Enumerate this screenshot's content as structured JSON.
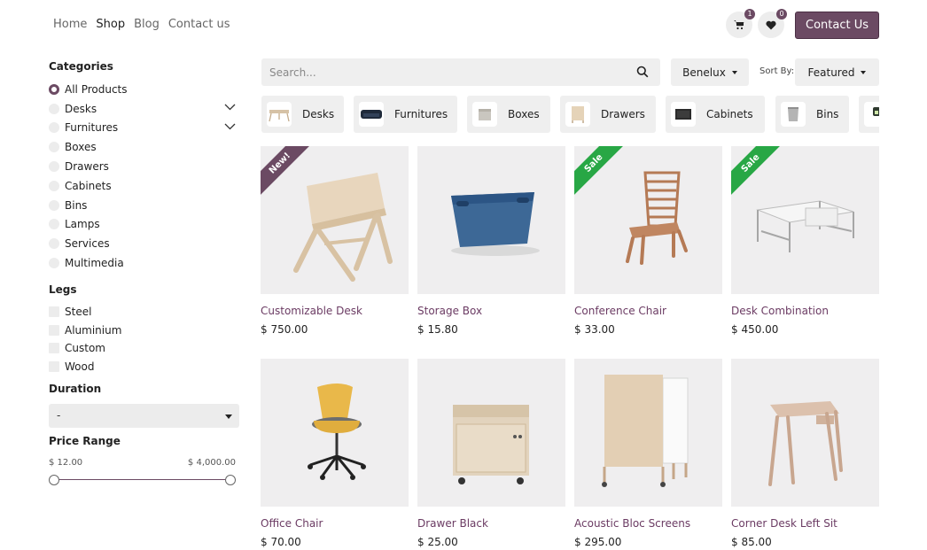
{
  "nav": {
    "items": [
      {
        "label": "Home",
        "active": false
      },
      {
        "label": "Shop",
        "active": true
      },
      {
        "label": "Blog",
        "active": false
      },
      {
        "label": "Contact us",
        "active": false
      }
    ],
    "cart_count": "1",
    "wishlist_count": "0",
    "contact_button": "Contact Us"
  },
  "colors": {
    "brand": "#6b4a63",
    "product_name": "#6b3b63",
    "ribbon_new": "#6b4a63",
    "ribbon_sale": "#28a745"
  },
  "sidebar": {
    "categories_title": "Categories",
    "categories": [
      {
        "label": "All Products",
        "checked": true,
        "expandable": false
      },
      {
        "label": "Desks",
        "checked": false,
        "expandable": true
      },
      {
        "label": "Furnitures",
        "checked": false,
        "expandable": true
      },
      {
        "label": "Boxes",
        "checked": false,
        "expandable": false
      },
      {
        "label": "Drawers",
        "checked": false,
        "expandable": false
      },
      {
        "label": "Cabinets",
        "checked": false,
        "expandable": false
      },
      {
        "label": "Bins",
        "checked": false,
        "expandable": false
      },
      {
        "label": "Lamps",
        "checked": false,
        "expandable": false
      },
      {
        "label": "Services",
        "checked": false,
        "expandable": false
      },
      {
        "label": "Multimedia",
        "checked": false,
        "expandable": false
      }
    ],
    "legs_title": "Legs",
    "legs": [
      "Steel",
      "Aluminium",
      "Custom",
      "Wood"
    ],
    "duration_title": "Duration",
    "duration_value": "-",
    "price_title": "Price Range",
    "price_min": "$ 12.00",
    "price_max": "$ 4,000.00"
  },
  "toolbar": {
    "search_placeholder": "Search...",
    "pricelist": "Benelux",
    "sort_label": "Sort By:",
    "sort_value": "Featured"
  },
  "category_pills": [
    {
      "label": "Desks",
      "icon": "desk-icon"
    },
    {
      "label": "Furnitures",
      "icon": "sofa-icon"
    },
    {
      "label": "Boxes",
      "icon": "box-icon"
    },
    {
      "label": "Drawers",
      "icon": "drawer-icon"
    },
    {
      "label": "Cabinets",
      "icon": "cabinet-icon"
    },
    {
      "label": "Bins",
      "icon": "bin-icon"
    },
    {
      "label": "",
      "icon": "lamp-icon"
    }
  ],
  "products": [
    {
      "name": "Customizable Desk",
      "price": "$ 750.00",
      "ribbon": "New!",
      "image": "desk-image"
    },
    {
      "name": "Storage Box",
      "price": "$ 15.80",
      "ribbon": "",
      "image": "storage-box-image"
    },
    {
      "name": "Conference Chair",
      "price": "$ 33.00",
      "ribbon": "Sale",
      "image": "wooden-chair-image"
    },
    {
      "name": "Desk Combination",
      "price": "$ 450.00",
      "ribbon": "Sale",
      "image": "desk-combination-image"
    },
    {
      "name": "Office Chair",
      "price": "$ 70.00",
      "ribbon": "",
      "image": "office-chair-image"
    },
    {
      "name": "Drawer Black",
      "price": "$ 25.00",
      "ribbon": "",
      "image": "drawer-image"
    },
    {
      "name": "Acoustic Bloc Screens",
      "price": "$ 295.00",
      "ribbon": "",
      "image": "acoustic-screens-image"
    },
    {
      "name": "Corner Desk Left Sit",
      "price": "$ 85.00",
      "ribbon": "",
      "image": "corner-desk-image"
    }
  ]
}
